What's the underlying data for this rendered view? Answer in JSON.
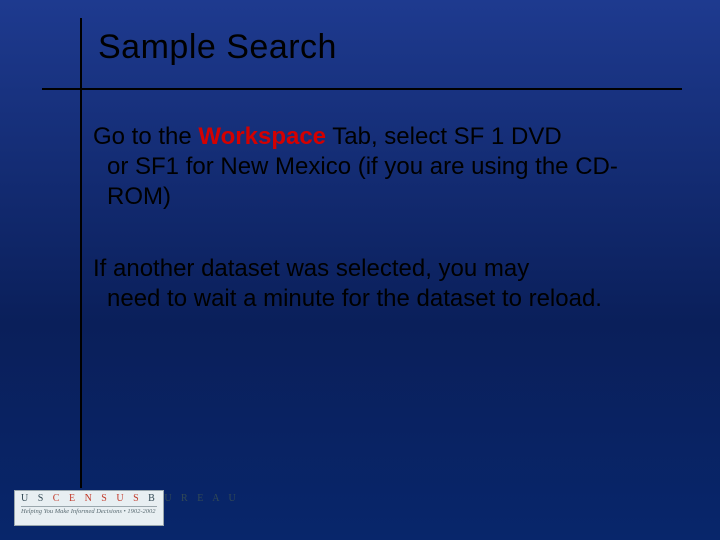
{
  "title": "Sample Search",
  "para1_lead": "Go to the ",
  "para1_hl": "Workspace",
  "para1_tail_line1": " Tab,  select SF 1 DVD",
  "para1_line2_3": "or SF1 for New Mexico (if you are using the CD-ROM)",
  "para2_line1": "If another dataset was selected, you may",
  "para2_rest": "need to wait a minute for the dataset to reload.",
  "logo_top_pre": "U S ",
  "logo_top_red": "C E N S U S",
  "logo_top_post": " B U R E A U",
  "logo_bottom": "Helping You Make Informed Decisions • 1902-2002"
}
